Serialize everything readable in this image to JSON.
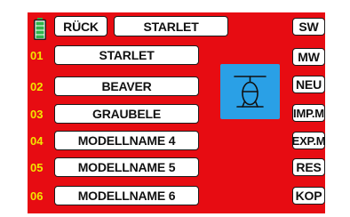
{
  "header": {
    "back_label": "RÜCK",
    "model_label": "STARLET"
  },
  "models": [
    {
      "num": "01",
      "name": "STARLET"
    },
    {
      "num": "02",
      "name": "BEAVER"
    },
    {
      "num": "03",
      "name": "GRAUBELE"
    },
    {
      "num": "04",
      "name": "MODELLNAME 4"
    },
    {
      "num": "05",
      "name": "MODELLNAME 5"
    },
    {
      "num": "06",
      "name": "MODELLNAME 6"
    }
  ],
  "side_buttons": [
    "SW",
    "MW",
    "NEU",
    "IMP.M",
    "EXP.M",
    "RES",
    "KOP"
  ],
  "icons": {
    "battery": "battery-icon",
    "model_type": "helicopter-icon"
  },
  "colors": {
    "background": "#e70c12",
    "number_text": "#f2e600",
    "icon_bg": "#2aa0e6",
    "battery": "#2fb34a"
  }
}
